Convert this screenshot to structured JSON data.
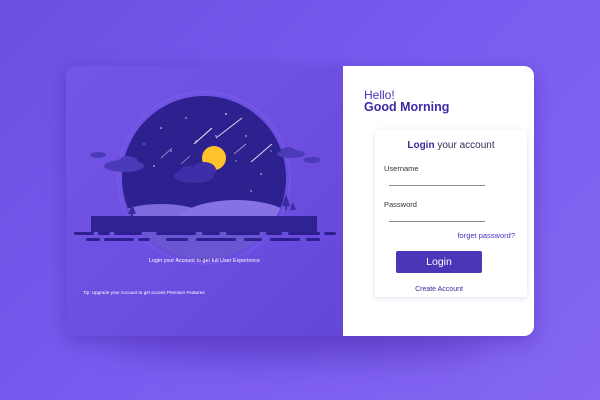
{
  "left_panel": {
    "info_text": "Login your Account to get full User Experience",
    "tip_text": "Tip: Upgrade your Account to get access Premium Features"
  },
  "greeting": {
    "line1": "Hello!",
    "line2": "Good Morning"
  },
  "login_form": {
    "title_bold": "Login",
    "title_rest": " your account",
    "username_label": "Username",
    "username_value": "",
    "password_label": "Password",
    "password_value": "",
    "forgot_link": "forget password?",
    "login_button": "Login",
    "create_account_link": "Create Account"
  },
  "colors": {
    "background": "#7257ea",
    "card_left": "#6b4de0",
    "primary_button": "#4d35b8",
    "heading": "#3c2aa8",
    "moon": "#ffc22b",
    "night_sky": "#2a1e86"
  },
  "icons": [
    "night-landscape-illustration",
    "moon-icon",
    "shooting-star-icon",
    "cloud-icon",
    "tree-icon"
  ]
}
